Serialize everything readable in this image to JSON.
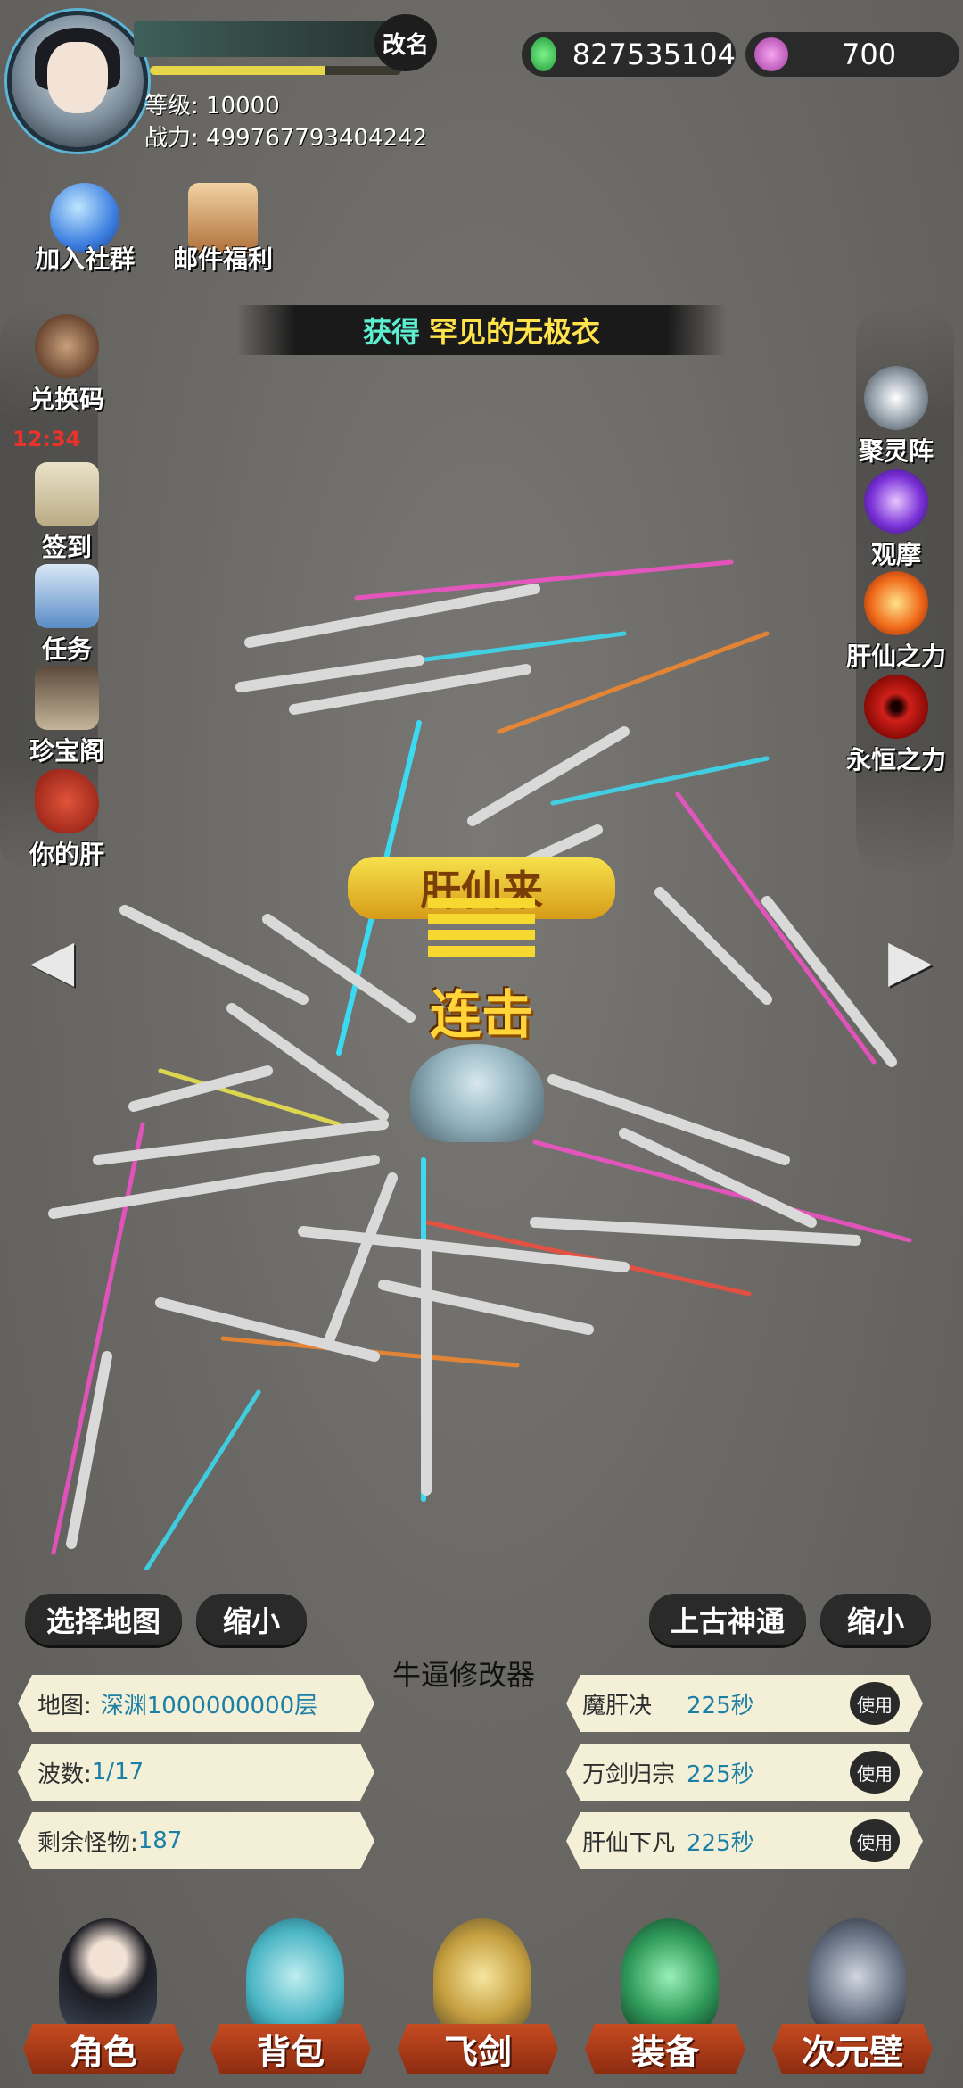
{
  "header": {
    "rename_label": "改名",
    "level_text": "等级: 10000",
    "power_text": "战力: 499767793404242",
    "exp_progress": 0.7,
    "gems": "827535104",
    "orbs": "700"
  },
  "top_icons": [
    {
      "label": "加入社群",
      "icon": "spirit-cat-icon"
    },
    {
      "label": "邮件福利",
      "icon": "mail-chest-icon"
    }
  ],
  "banner": {
    "prefix": "获得",
    "item": "罕见的无极衣"
  },
  "left_menu": [
    {
      "label": "兑换码",
      "icon": "cauldron-icon",
      "timer": "12:34"
    },
    {
      "label": "签到",
      "icon": "scroll-icon"
    },
    {
      "label": "任务",
      "icon": "task-scroll-icon"
    },
    {
      "label": "珍宝阁",
      "icon": "pavilion-icon"
    },
    {
      "label": "你的肝",
      "icon": "liver-icon"
    }
  ],
  "right_menu": [
    {
      "label": "聚灵阵",
      "icon": "spirit-array-icon"
    },
    {
      "label": "观摩",
      "icon": "purple-orb-icon"
    },
    {
      "label": "肝仙之力",
      "icon": "fire-orb-icon"
    },
    {
      "label": "永恒之力",
      "icon": "sharingan-icon"
    }
  ],
  "battle": {
    "combo_title": "肝仙来",
    "combo_label": "连击"
  },
  "controls": {
    "select_map": "选择地图",
    "shrink_left": "缩小",
    "ancient_power": "上古神通",
    "shrink_right": "缩小",
    "modifier_title": "牛逼修改器"
  },
  "info": {
    "map_label": "地图:",
    "map_value": "深渊1000000000层",
    "wave_label": "波数:",
    "wave_value": "1/17",
    "monsters_label": "剩余怪物:",
    "monsters_value": "187"
  },
  "skills": [
    {
      "name": "魔肝决",
      "cd": "225秒",
      "use": "使用"
    },
    {
      "name": "万剑归宗",
      "cd": "225秒",
      "use": "使用"
    },
    {
      "name": "肝仙下凡",
      "cd": "225秒",
      "use": "使用"
    }
  ],
  "nav": [
    {
      "label": "角色",
      "icon": "character-icon"
    },
    {
      "label": "背包",
      "icon": "bag-icon"
    },
    {
      "label": "飞剑",
      "icon": "flying-sword-icon"
    },
    {
      "label": "装备",
      "icon": "equipment-icon"
    },
    {
      "label": "次元壁",
      "icon": "dimension-wall-icon"
    }
  ],
  "colors": {
    "accent_gold": "#ffd53a",
    "nav_tab": "#c64b22",
    "info_bg": "#f4f0d8",
    "value_blue": "#1b7fa6"
  }
}
